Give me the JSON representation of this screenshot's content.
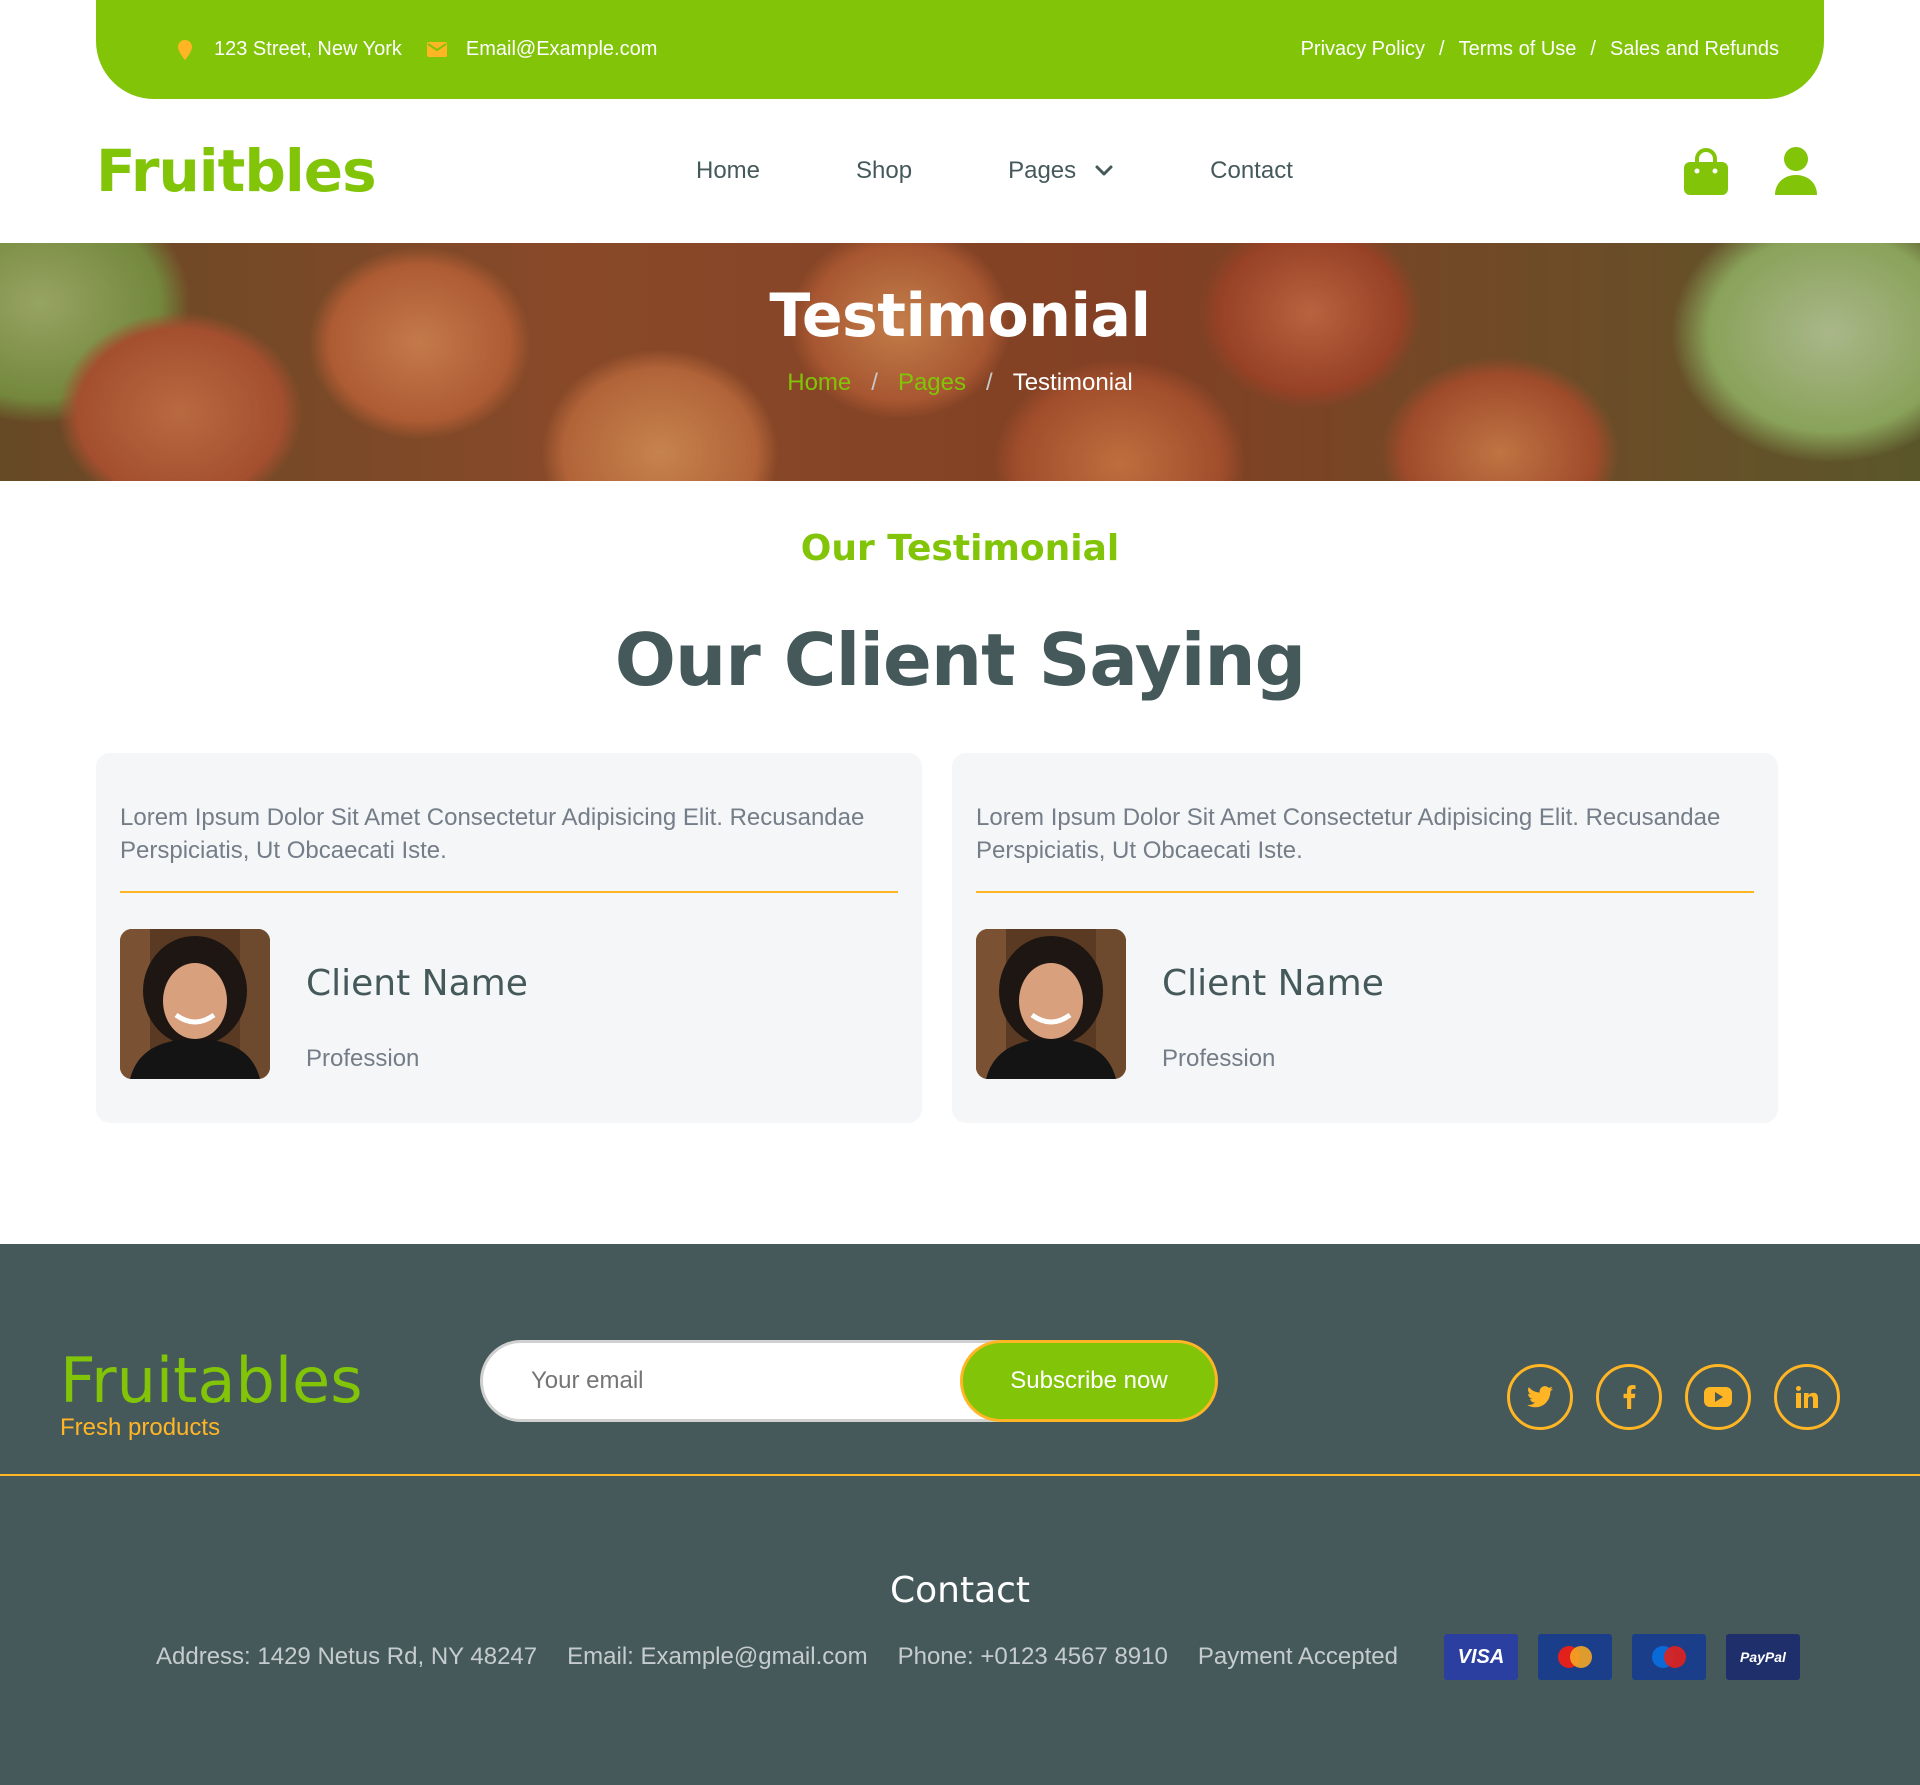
{
  "topbar": {
    "address": "123 Street, New York",
    "email": "Email@Example.com",
    "links": [
      "Privacy Policy",
      "Terms of Use",
      "Sales and Refunds"
    ],
    "separator": "/"
  },
  "navbar": {
    "brand": "Fruitbles",
    "items": [
      "Home",
      "Shop",
      "Pages",
      "Contact"
    ]
  },
  "hero": {
    "title": "Testimonial",
    "breadcrumb": [
      "Home",
      "Pages",
      "Testimonial"
    ],
    "separator": "/"
  },
  "testimonials": {
    "subtitle": "Our Testimonial",
    "title": "Our Client Saying",
    "items": [
      {
        "quote": "Lorem Ipsum Dolor Sit Amet Consectetur Adipisicing Elit. Recusandae Perspiciatis, Ut Obcaecati Iste.",
        "name": "Client Name",
        "profession": "Profession"
      },
      {
        "quote": "Lorem Ipsum Dolor Sit Amet Consectetur Adipisicing Elit. Recusandae Perspiciatis, Ut Obcaecati Iste.",
        "name": "Client Name",
        "profession": "Profession"
      }
    ]
  },
  "footer": {
    "brand": "Fruitables",
    "tagline": "Fresh products",
    "email_placeholder": "Your email",
    "subscribe_label": "Subscribe now",
    "socials": [
      "twitter-icon",
      "facebook-icon",
      "youtube-icon",
      "linkedin-icon"
    ],
    "contact_title": "Contact",
    "address": "Address: 1429 Netus Rd, NY 48247",
    "email": "Email: Example@gmail.com",
    "phone": "Phone: +0123 4567 8910",
    "payment_label": "Payment Accepted",
    "payment_methods": [
      "VISA",
      "MasterCard",
      "Maestro",
      "PayPal"
    ]
  },
  "colors": {
    "primary": "#81c408",
    "secondary": "#ffb524",
    "dark": "#45595b",
    "muted": "#747d88"
  }
}
